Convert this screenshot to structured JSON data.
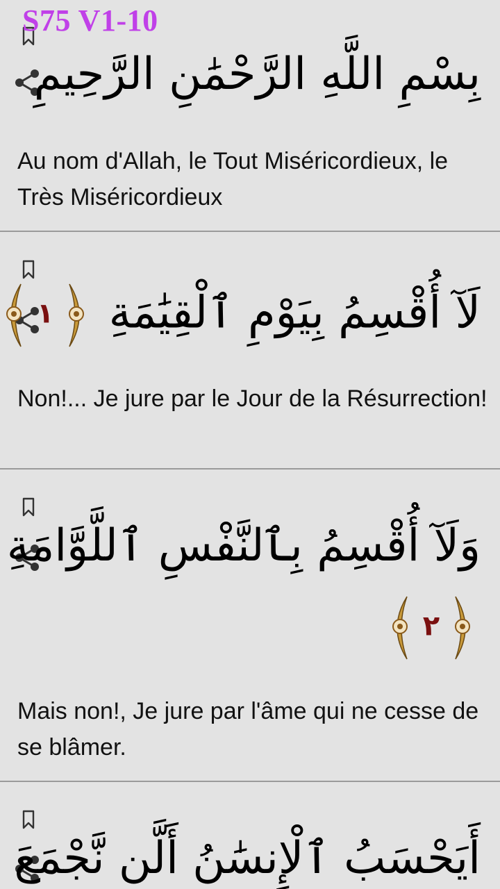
{
  "overlay": {
    "title": "S75 V1-10"
  },
  "verses": [
    {
      "arabic": "بِسْمِ اللَّهِ الرَّحْمَٰنِ الرَّحِيمِ",
      "translation": "Au nom d'Allah, le Tout Miséricordieux, le Très Miséricordieux"
    },
    {
      "arabic": "لَآ أُقْسِمُ بِيَوْمِ ٱلْقِيَٰمَةِ",
      "number": "١",
      "translation": "Non!... Je jure par le Jour de la Résurrection!"
    },
    {
      "arabic": "وَلَآ أُقْسِمُ بِٱلنَّفْسِ ٱللَّوَّامَةِ",
      "number": "٢",
      "translation": "Mais non!, Je jure par l'âme qui ne cesse de se blâmer."
    },
    {
      "arabic": "أَيَحْسَبُ ٱلْإِنسَٰنُ أَلَّن نَّجْمَعَ"
    }
  ],
  "icons": {
    "bookmark": "bookmark-icon",
    "share": "share-icon"
  },
  "colors": {
    "title": "#c040e8",
    "marker_number": "#7a1010",
    "marker_gold": "#c99a3a",
    "background": "#e3e3e3"
  }
}
